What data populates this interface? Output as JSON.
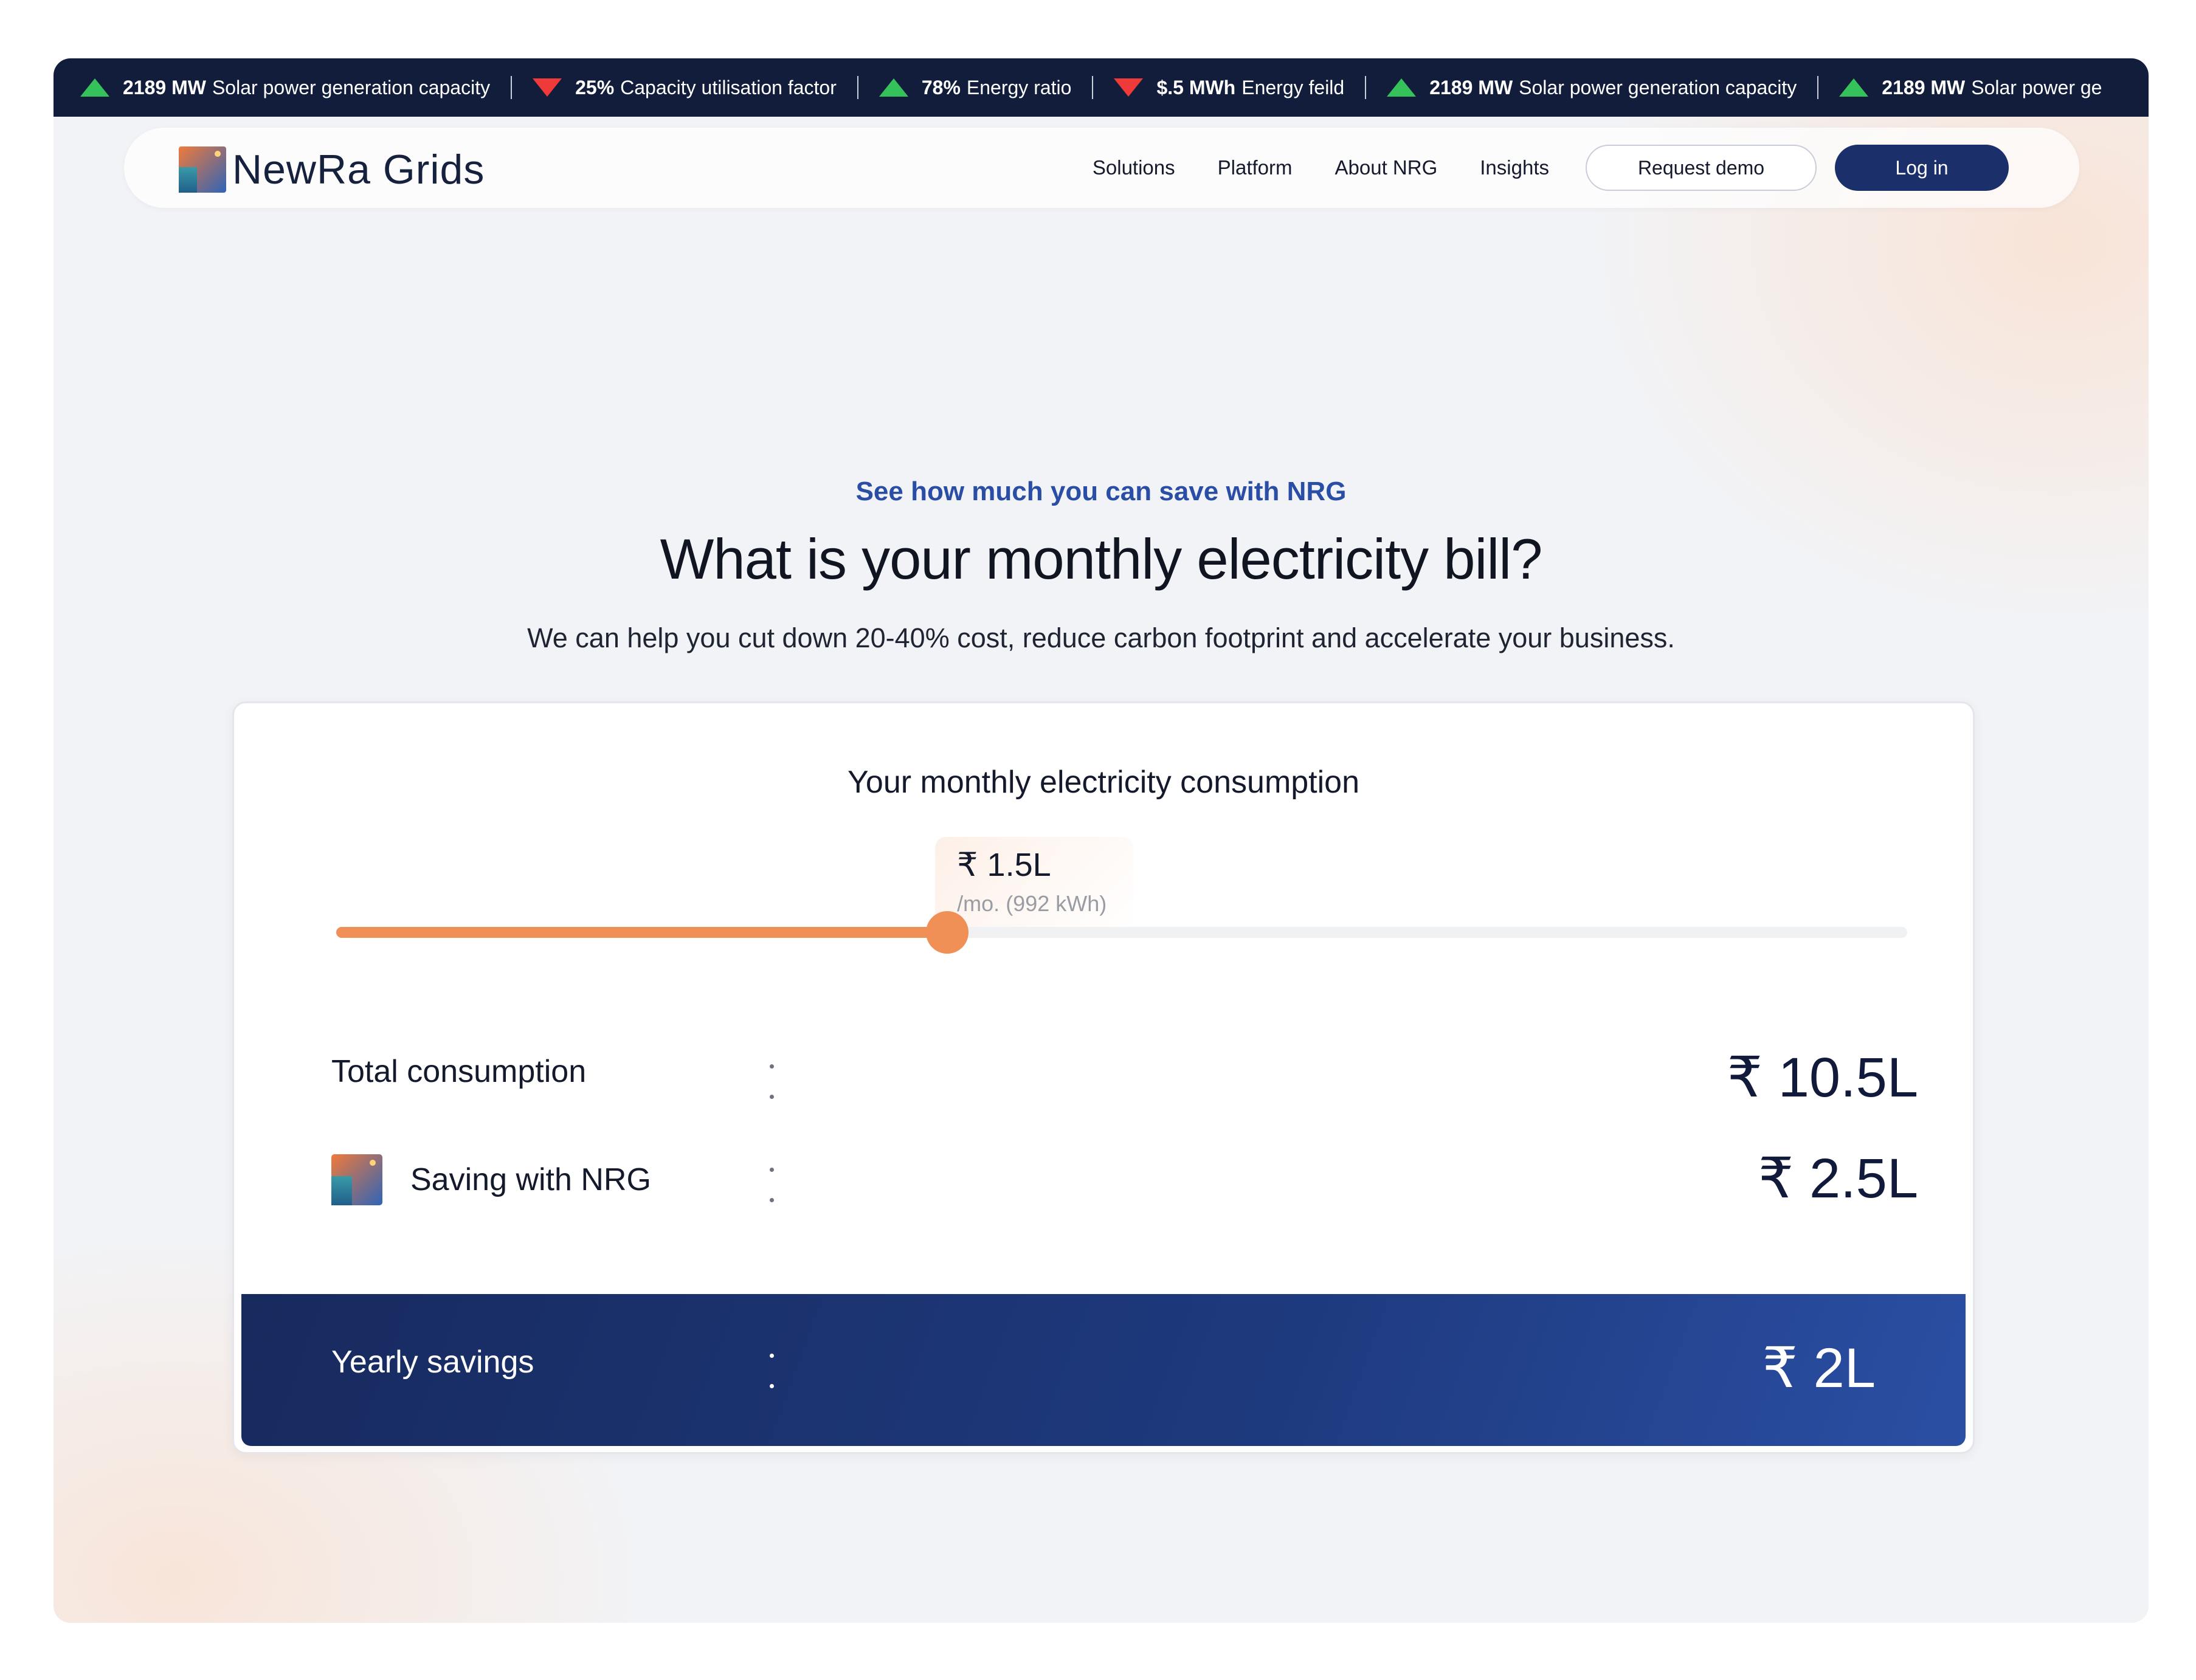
{
  "ticker": {
    "items": [
      {
        "trend": "up",
        "value": "2189 MW",
        "label": "Solar power generation capacity"
      },
      {
        "trend": "down",
        "value": "25%",
        "label": "Capacity utilisation factor"
      },
      {
        "trend": "up",
        "value": "78%",
        "label": "Energy ratio"
      },
      {
        "trend": "down",
        "value": "$.5 MWh",
        "label": "Energy feild"
      },
      {
        "trend": "up",
        "value": "2189 MW",
        "label": "Solar power generation capacity"
      },
      {
        "trend": "up",
        "value": "2189 MW",
        "label": "Solar power ge"
      }
    ],
    "up_color": "#35c25b",
    "down_color": "#ef3a3a"
  },
  "nav": {
    "brand": "NewRa Grids",
    "links": [
      "Solutions",
      "Platform",
      "About NRG",
      "Insights"
    ],
    "request_demo": "Request demo",
    "login": "Log in"
  },
  "hero": {
    "kicker": "See how much you can save with NRG",
    "title": "What is your monthly electricity bill?",
    "subtitle": "We can help you cut down 20-40% cost, reduce carbon footprint and accelerate your business."
  },
  "calculator": {
    "title": "Your monthly electricity consumption",
    "slider": {
      "value_label": "₹ 1.5L",
      "sub_label": "/mo. (992 kWh)",
      "fraction": 0.389
    },
    "rows": {
      "total_label": "Total consumption",
      "total_value": "₹ 10.5L",
      "saving_label": "Saving with NRG",
      "saving_value": "₹ 2.5L",
      "yearly_label": "Yearly savings",
      "yearly_value": "₹ 2L"
    }
  },
  "colors": {
    "accent_orange": "#f08f56",
    "brand_navy": "#1b2f6b",
    "kicker_blue": "#2a4ea5"
  }
}
